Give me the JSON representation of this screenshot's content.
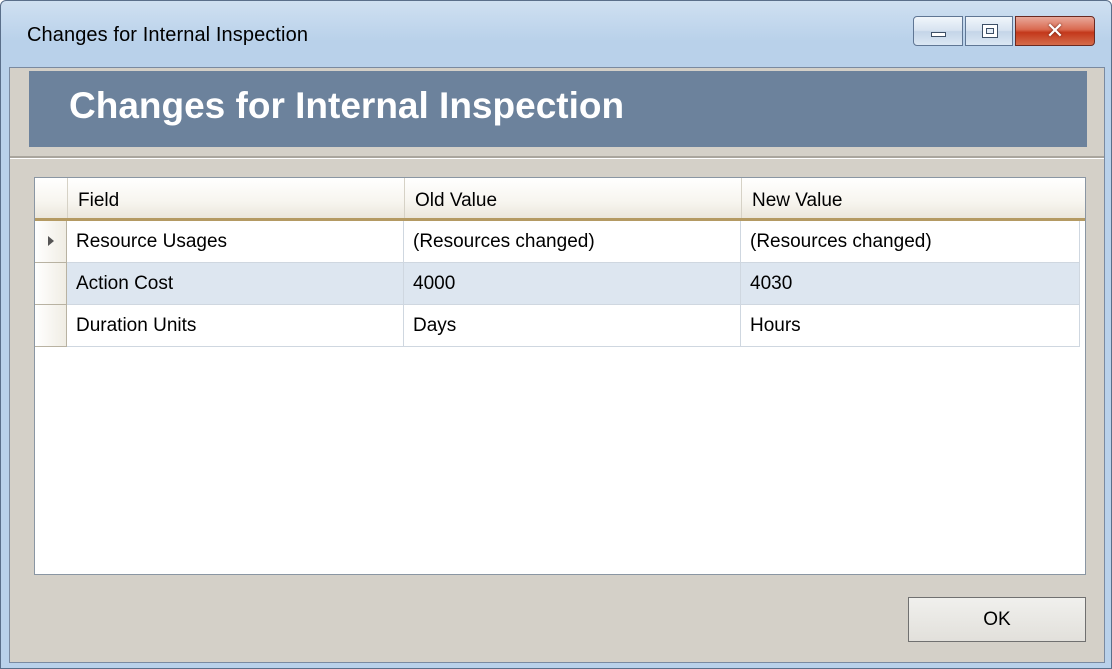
{
  "window": {
    "title": "Changes for Internal Inspection",
    "controls": {
      "minimize": "minimize-icon",
      "maximize": "maximize-icon",
      "close": "close-icon",
      "close_glyph": "✕"
    }
  },
  "header": {
    "title": "Changes for Internal Inspection"
  },
  "table": {
    "columns": [
      "Field",
      "Old Value",
      "New Value"
    ],
    "rows": [
      {
        "field": "Resource Usages",
        "old_value": "(Resources changed)",
        "new_value": "(Resources changed)",
        "current": true
      },
      {
        "field": "Action Cost",
        "old_value": "4000",
        "new_value": "4030",
        "current": false
      },
      {
        "field": "Duration Units",
        "old_value": "Days",
        "new_value": "Hours",
        "current": false
      }
    ]
  },
  "footer": {
    "ok_label": "OK"
  },
  "colors": {
    "banner": "#6c829c",
    "selected_row": "#dde6f0",
    "close_button": "#c3381b",
    "dialog_body": "#d4d0c8"
  }
}
